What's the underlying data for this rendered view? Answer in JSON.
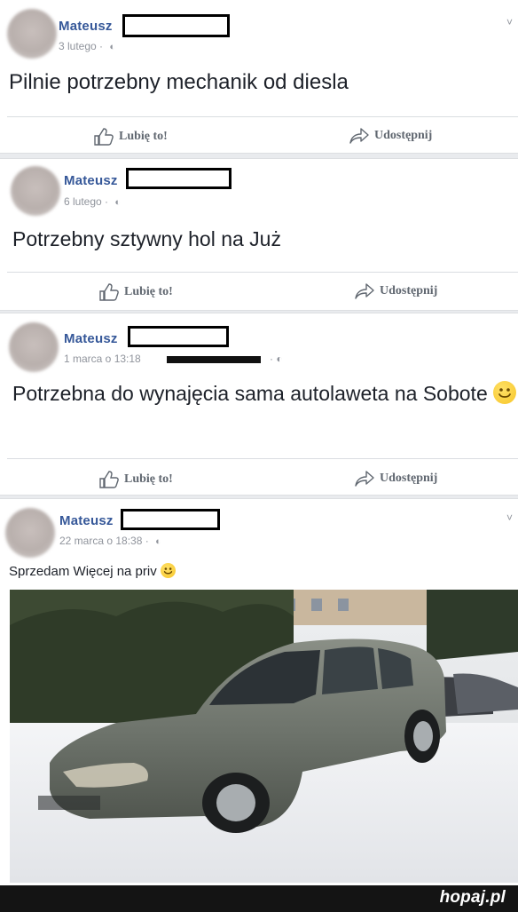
{
  "posts": [
    {
      "author": "Mateusz",
      "date": "3 lutego",
      "globe": "🌐",
      "text": "Pilnie potrzebny mechanik od diesla",
      "like_label": "Lubię to!",
      "share_label": "Udostępnij"
    },
    {
      "author": "Mateusz",
      "date": "6 lutego",
      "globe": "🌐",
      "text": "Potrzebny sztywny hol na Już",
      "like_label": "Lubię to!",
      "share_label": "Udostępnij"
    },
    {
      "author": "Mateusz",
      "date": "1 marca o 13:18",
      "globe": "🌐",
      "text": "Potrzebna do wynajęcia sama autolaweta na Sobote",
      "like_label": "Lubię to!",
      "share_label": "Udostępnij"
    },
    {
      "author": "Mateusz",
      "date": "22 marca o 18:38",
      "globe": "🌐",
      "text": "Sprzedam Więcej na priv"
    }
  ],
  "icons": {
    "like": "thumbs-up-icon",
    "share": "share-arrow-icon",
    "globe": "globe-icon",
    "emoji": "smiley-emoji-icon",
    "options": "chevron-down-icon"
  },
  "chevron": "˅",
  "watermark": "hopaj.pl",
  "colors": {
    "author": "#365899",
    "meta": "#90949c",
    "text": "#1d2129",
    "footer": "#141414"
  }
}
